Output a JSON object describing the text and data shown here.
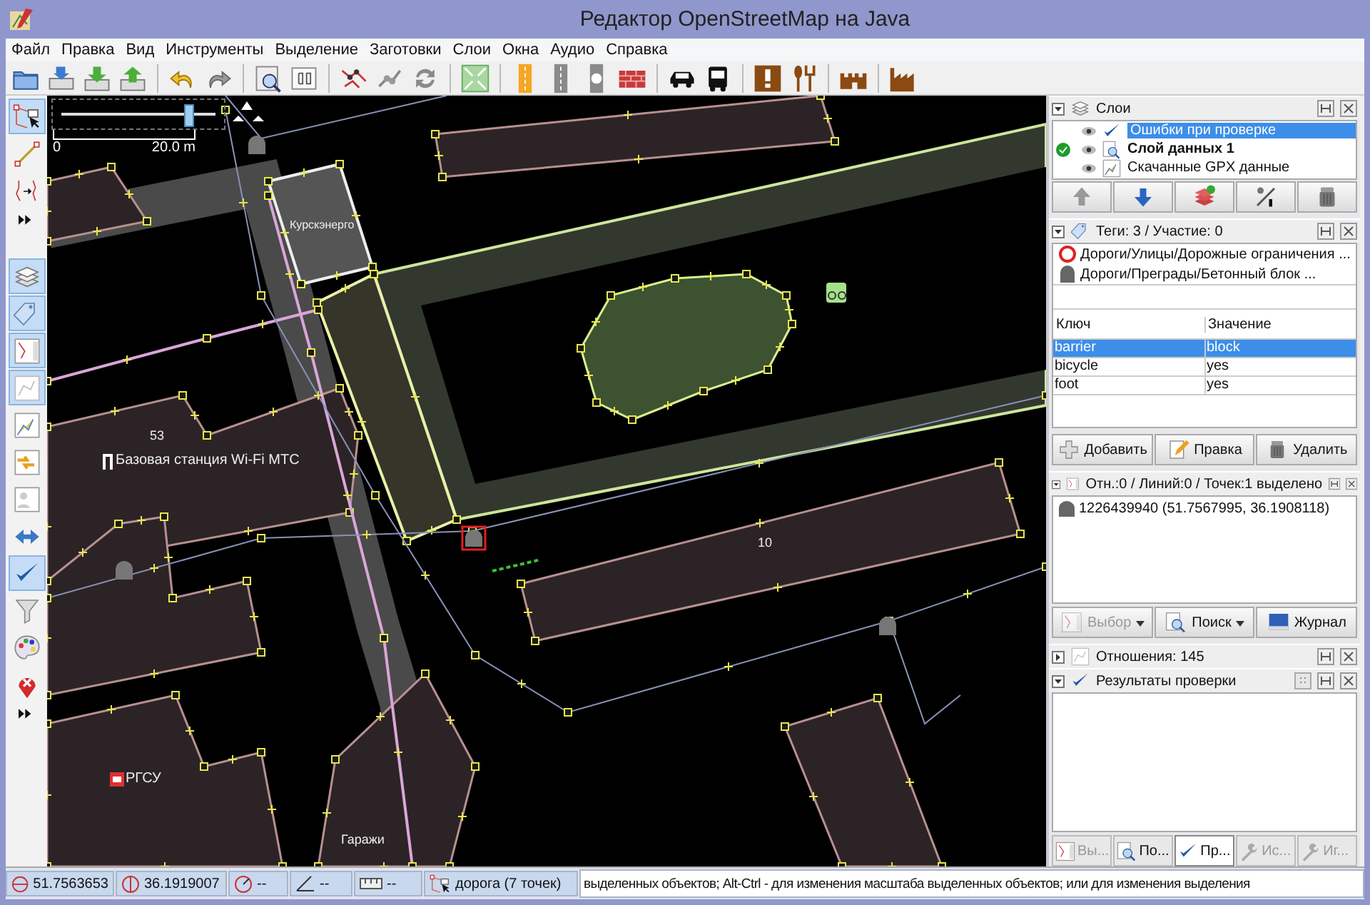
{
  "window": {
    "title": "Редактор OpenStreetMap на Java"
  },
  "menu": [
    "Файл",
    "Правка",
    "Вид",
    "Инструменты",
    "Выделение",
    "Заготовки",
    "Слои",
    "Окна",
    "Аудио",
    "Справка"
  ],
  "map": {
    "zoom_slider": {
      "level": 0.82
    },
    "scale": {
      "start": "0",
      "end": "20.0 m"
    },
    "labels": [
      {
        "kind": "building",
        "text": "Курскэнерго"
      },
      {
        "kind": "housenumber",
        "text": "53"
      },
      {
        "kind": "mast",
        "text": "Базовая станция Wi-Fi МТС"
      },
      {
        "kind": "housenumber",
        "text": "10"
      },
      {
        "kind": "office",
        "text": "РГСУ"
      },
      {
        "kind": "area",
        "text": "Гаражи"
      }
    ]
  },
  "left_toolbar": {
    "modes": [
      {
        "kind": "select",
        "selected": true
      },
      {
        "kind": "draw",
        "selected": false
      },
      {
        "kind": "zoom",
        "selected": false
      }
    ],
    "toggles": [
      {
        "kind": "layers",
        "selected": true
      },
      {
        "kind": "tags",
        "selected": true
      },
      {
        "kind": "selection",
        "selected": true
      },
      {
        "kind": "relations",
        "selected": true
      },
      {
        "kind": "history",
        "selected": false
      },
      {
        "kind": "conflicts",
        "selected": false
      },
      {
        "kind": "authors",
        "selected": false
      },
      {
        "kind": "changesets",
        "selected": false
      },
      {
        "kind": "validation",
        "selected": true
      },
      {
        "kind": "filter",
        "selected": false
      },
      {
        "kind": "styles",
        "selected": false
      },
      {
        "kind": "notes",
        "selected": false
      }
    ]
  },
  "sidebar": {
    "layers": {
      "title": "Слои",
      "expanded": true,
      "items": [
        {
          "name": "Ошибки при проверке",
          "selected": true,
          "active": false
        },
        {
          "name": "Слой данных 1",
          "selected": false,
          "active": true
        },
        {
          "name": "Скачанные GPX данные",
          "selected": false,
          "active": false
        }
      ]
    },
    "tags": {
      "title": "Теги: 3 / Участие: 0",
      "expanded": true,
      "presets": [
        {
          "kind": "restriction",
          "text": "Дороги/Улицы/Дорожные ограничения ..."
        },
        {
          "kind": "block",
          "text": "Дороги/Преграды/Бетонный блок ..."
        }
      ],
      "columns": [
        "Ключ",
        "Значение"
      ],
      "rows": [
        {
          "key": "barrier",
          "value": "block",
          "selected": true
        },
        {
          "key": "bicycle",
          "value": "yes",
          "selected": false
        },
        {
          "key": "foot",
          "value": "yes",
          "selected": false
        }
      ],
      "buttons": [
        {
          "kind": "add",
          "label": "Добавить"
        },
        {
          "kind": "edit",
          "label": "Правка"
        },
        {
          "kind": "delete",
          "label": "Удалить"
        }
      ]
    },
    "selection": {
      "title": "Отн.:0 / Линий:0 / Точек:1 выделено",
      "expanded": true,
      "items": [
        "1226439940 (51.7567995, 36.1908118)"
      ],
      "buttons": [
        {
          "kind": "select",
          "label": "Выбор",
          "disabled": true,
          "dropdown": true
        },
        {
          "kind": "search",
          "label": "Поиск",
          "disabled": false,
          "dropdown": true
        },
        {
          "kind": "history",
          "label": "Журнал",
          "disabled": false,
          "dropdown": false
        }
      ]
    },
    "relations": {
      "title": "Отношения: 145",
      "expanded": false
    },
    "validation": {
      "title": "Результаты проверки",
      "expanded": true
    },
    "tabs": [
      {
        "kind": "select",
        "label": "Вы...",
        "selected": false,
        "disabled": true
      },
      {
        "kind": "search",
        "label": "По...",
        "selected": false,
        "disabled": false
      },
      {
        "kind": "check",
        "label": "Пр...",
        "selected": true,
        "disabled": false
      },
      {
        "kind": "fix",
        "label": "Ис...",
        "selected": false,
        "disabled": true
      },
      {
        "kind": "ignore",
        "label": "Иг...",
        "selected": false,
        "disabled": true
      }
    ]
  },
  "status_bar": {
    "latitude": "51.7563653",
    "longitude": "36.1919007",
    "heading": "--",
    "angle": "--",
    "length": "--",
    "name": "дорога (7 точек)",
    "help": "выделенных объектов; Alt-Ctrl - для изменения масштаба выделенных объектов; или для изменения выделения"
  }
}
